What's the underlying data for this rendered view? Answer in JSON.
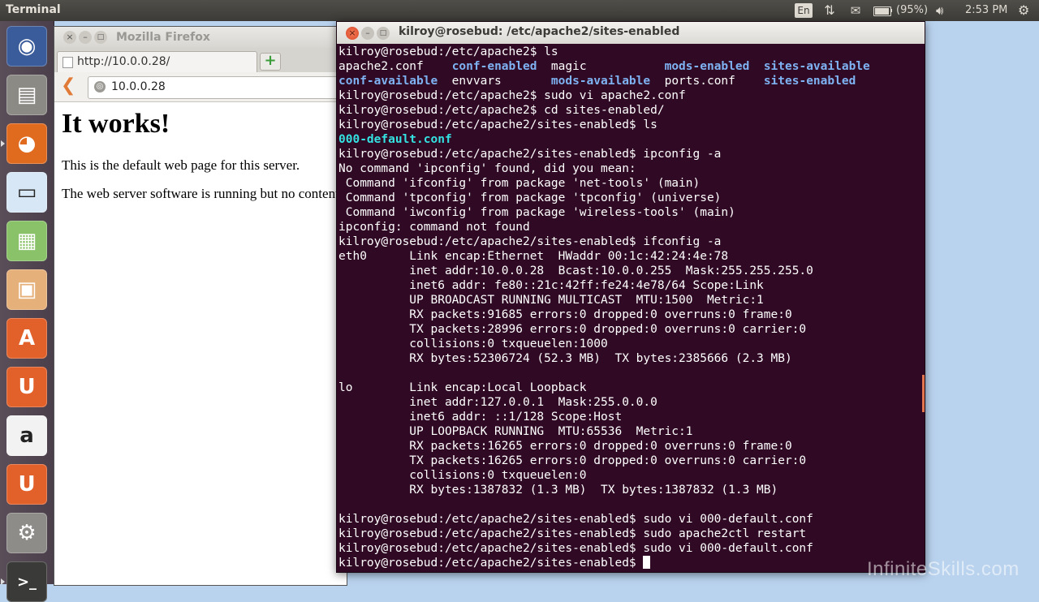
{
  "top_panel": {
    "app_title": "Terminal",
    "keyboard_layout": "En",
    "battery_text": "(95%)",
    "battery_level": 0.95,
    "clock": "2:53 PM",
    "icons": [
      "network-icon",
      "mail-icon",
      "battery-icon",
      "sound-icon",
      "session-gear-icon"
    ]
  },
  "launcher": {
    "items": [
      {
        "name": "ubuntu-dash",
        "glyph": "◉",
        "color": "#3b5c9a"
      },
      {
        "name": "files",
        "glyph": "▤",
        "color": "#8c8a85"
      },
      {
        "name": "firefox",
        "glyph": "◕",
        "color": "#e06b1f",
        "active": true
      },
      {
        "name": "libreoffice-writer",
        "glyph": "▭",
        "color": "#d7e7f5"
      },
      {
        "name": "libreoffice-calc",
        "glyph": "▦",
        "color": "#8ac26a"
      },
      {
        "name": "libreoffice-impress",
        "glyph": "▣",
        "color": "#e6b07a"
      },
      {
        "name": "software-center",
        "glyph": "A",
        "color": "#e2612a"
      },
      {
        "name": "ubuntu-one",
        "glyph": "U",
        "color": "#e2612a"
      },
      {
        "name": "amazon",
        "glyph": "a",
        "color": "#f2f2f2"
      },
      {
        "name": "ubuntu-one-music",
        "glyph": "U",
        "color": "#e2612a"
      },
      {
        "name": "system-settings",
        "glyph": "⚙",
        "color": "#8e8c88"
      },
      {
        "name": "terminal",
        "glyph": ">_",
        "color": "#3a3a38",
        "active": true
      }
    ]
  },
  "firefox": {
    "window_title": "Mozilla Firefox",
    "tab_title": "http://10.0.0.28/",
    "new_tab_label": "+",
    "url": "10.0.0.28",
    "page": {
      "heading": "It works!",
      "para1": "This is the default web page for this server.",
      "para2": "The web server software is running but no content has been added, yet."
    }
  },
  "terminal": {
    "title": "kilroy@rosebud: /etc/apache2/sites-enabled",
    "lines": [
      [
        {
          "t": "kilroy@rosebud:/etc/apache2$ ls"
        }
      ],
      [
        {
          "t": "apache2.conf    "
        },
        {
          "t": "conf-enabled",
          "c": "dir"
        },
        {
          "t": "  magic           "
        },
        {
          "t": "mods-enabled",
          "c": "dir"
        },
        {
          "t": "  "
        },
        {
          "t": "sites-available",
          "c": "dir"
        }
      ],
      [
        {
          "t": "conf-available",
          "c": "dir"
        },
        {
          "t": "  envvars       "
        },
        {
          "t": "mods-available",
          "c": "dir"
        },
        {
          "t": "  ports.conf    "
        },
        {
          "t": "sites-enabled",
          "c": "dir"
        }
      ],
      [
        {
          "t": "kilroy@rosebud:/etc/apache2$ sudo vi apache2.conf"
        }
      ],
      [
        {
          "t": "kilroy@rosebud:/etc/apache2$ cd sites-enabled/"
        }
      ],
      [
        {
          "t": "kilroy@rosebud:/etc/apache2/sites-enabled$ ls"
        }
      ],
      [
        {
          "t": "000-default.conf",
          "c": "cyan"
        }
      ],
      [
        {
          "t": "kilroy@rosebud:/etc/apache2/sites-enabled$ ipconfig -a"
        }
      ],
      [
        {
          "t": "No command 'ipconfig' found, did you mean:"
        }
      ],
      [
        {
          "t": " Command 'ifconfig' from package 'net-tools' (main)"
        }
      ],
      [
        {
          "t": " Command 'tpconfig' from package 'tpconfig' (universe)"
        }
      ],
      [
        {
          "t": " Command 'iwconfig' from package 'wireless-tools' (main)"
        }
      ],
      [
        {
          "t": "ipconfig: command not found"
        }
      ],
      [
        {
          "t": "kilroy@rosebud:/etc/apache2/sites-enabled$ ifconfig -a"
        }
      ],
      [
        {
          "t": "eth0      Link encap:Ethernet  HWaddr 00:1c:42:24:4e:78"
        }
      ],
      [
        {
          "t": "          inet addr:10.0.0.28  Bcast:10.0.0.255  Mask:255.255.255.0"
        }
      ],
      [
        {
          "t": "          inet6 addr: fe80::21c:42ff:fe24:4e78/64 Scope:Link"
        }
      ],
      [
        {
          "t": "          UP BROADCAST RUNNING MULTICAST  MTU:1500  Metric:1"
        }
      ],
      [
        {
          "t": "          RX packets:91685 errors:0 dropped:0 overruns:0 frame:0"
        }
      ],
      [
        {
          "t": "          TX packets:28996 errors:0 dropped:0 overruns:0 carrier:0"
        }
      ],
      [
        {
          "t": "          collisions:0 txqueuelen:1000"
        }
      ],
      [
        {
          "t": "          RX bytes:52306724 (52.3 MB)  TX bytes:2385666 (2.3 MB)"
        }
      ],
      [
        {
          "t": ""
        }
      ],
      [
        {
          "t": "lo        Link encap:Local Loopback"
        }
      ],
      [
        {
          "t": "          inet addr:127.0.0.1  Mask:255.0.0.0"
        }
      ],
      [
        {
          "t": "          inet6 addr: ::1/128 Scope:Host"
        }
      ],
      [
        {
          "t": "          UP LOOPBACK RUNNING  MTU:65536  Metric:1"
        }
      ],
      [
        {
          "t": "          RX packets:16265 errors:0 dropped:0 overruns:0 frame:0"
        }
      ],
      [
        {
          "t": "          TX packets:16265 errors:0 dropped:0 overruns:0 carrier:0"
        }
      ],
      [
        {
          "t": "          collisions:0 txqueuelen:0"
        }
      ],
      [
        {
          "t": "          RX bytes:1387832 (1.3 MB)  TX bytes:1387832 (1.3 MB)"
        }
      ],
      [
        {
          "t": ""
        }
      ],
      [
        {
          "t": "kilroy@rosebud:/etc/apache2/sites-enabled$ sudo vi 000-default.conf"
        }
      ],
      [
        {
          "t": "kilroy@rosebud:/etc/apache2/sites-enabled$ sudo apache2ctl restart"
        }
      ],
      [
        {
          "t": "kilroy@rosebud:/etc/apache2/sites-enabled$ sudo vi 000-default.conf"
        }
      ],
      [
        {
          "t": "kilroy@rosebud:/etc/apache2/sites-enabled$ "
        }
      ]
    ]
  },
  "watermark": "InfiniteSkills.com"
}
